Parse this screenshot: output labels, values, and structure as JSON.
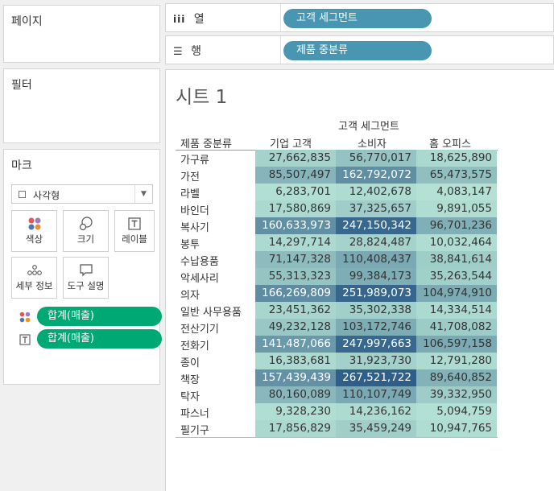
{
  "cards": {
    "pages_title": "페이지",
    "filters_title": "필터",
    "marks_title": "마크"
  },
  "marks": {
    "type_label": "사각형",
    "buttons": {
      "color": "색상",
      "size": "크기",
      "label": "레이블",
      "detail": "세부 정보",
      "tooltip": "도구 설명"
    },
    "pills": [
      "합계(매출)",
      "합계(매출)"
    ]
  },
  "shelves": {
    "columns_label": "열",
    "columns_pill": "고객 세그먼트",
    "rows_label": "행",
    "rows_pill": "제품 중분류"
  },
  "view": {
    "sheet_title": "시트 1",
    "column_group_header": "고객 세그먼트",
    "row_header": "제품 중분류",
    "columns": [
      "기업 고객",
      "소비자",
      "홈 오피스"
    ]
  },
  "chart_data": {
    "type": "heatmap",
    "title": "시트 1",
    "xlabel": "고객 세그먼트",
    "ylabel": "제품 중분류",
    "columns": [
      "기업 고객",
      "소비자",
      "홈 오피스"
    ],
    "rows": [
      "가구류",
      "가전",
      "라벨",
      "바인더",
      "복사기",
      "봉투",
      "수납용품",
      "악세사리",
      "의자",
      "일반 사무용품",
      "전산기기",
      "전화기",
      "종이",
      "책장",
      "탁자",
      "파스너",
      "필기구"
    ],
    "values": [
      [
        27662835,
        56770017,
        18625890
      ],
      [
        85507497,
        162792072,
        65473575
      ],
      [
        6283701,
        12402678,
        4083147
      ],
      [
        17580869,
        37325657,
        9891055
      ],
      [
        160633973,
        247150342,
        96701236
      ],
      [
        14297714,
        28824487,
        10032464
      ],
      [
        71147328,
        110408437,
        38841614
      ],
      [
        55313323,
        99384173,
        35263544
      ],
      [
        166269809,
        251989073,
        104974910
      ],
      [
        23451362,
        35302338,
        14334514
      ],
      [
        49232128,
        103172746,
        41708082
      ],
      [
        141487066,
        247997663,
        106597158
      ],
      [
        16383681,
        31923730,
        12791280
      ],
      [
        157439439,
        267521722,
        89640852
      ],
      [
        80160089,
        110107749,
        39332950
      ],
      [
        9328230,
        14236162,
        5094759
      ],
      [
        17856829,
        35459249,
        10947765
      ]
    ],
    "color_scale": {
      "min_color": "#b7e4d6",
      "max_color": "#2f5f88"
    }
  }
}
